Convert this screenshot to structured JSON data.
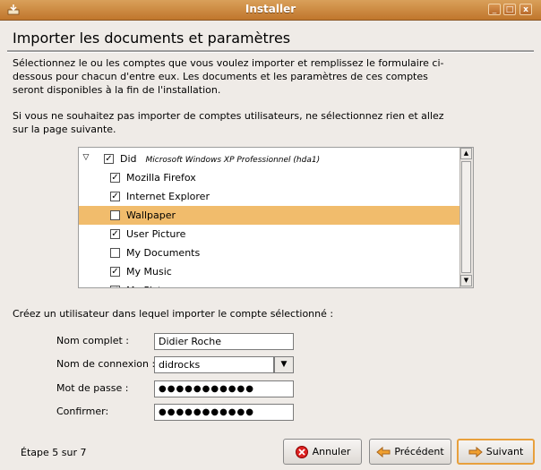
{
  "window": {
    "title": "Installer",
    "minimize_glyph": "_",
    "maximize_glyph": "□",
    "close_glyph": "x"
  },
  "page": {
    "heading": "Importer les documents et paramètres",
    "intro": "Sélectionnez le ou les comptes que vous voulez importer et remplissez le formulaire ci-dessous pour chacun d'entre eux. Les documents et les paramètres de ces comptes seront disponibles à la fin de l'installation.",
    "note": "Si vous ne souhaitez pas importer de comptes utilisateurs, ne sélectionnez rien et allez sur la page suivante."
  },
  "tree": {
    "account": {
      "name": "Did",
      "os": "Microsoft Windows XP Professionnel (hda1)",
      "checked": true,
      "expanded": true
    },
    "items": [
      {
        "label": "Mozilla Firefox",
        "checked": true,
        "selected": false
      },
      {
        "label": "Internet Explorer",
        "checked": true,
        "selected": false
      },
      {
        "label": "Wallpaper",
        "checked": false,
        "selected": true
      },
      {
        "label": "User Picture",
        "checked": true,
        "selected": false
      },
      {
        "label": "My Documents",
        "checked": false,
        "selected": false
      },
      {
        "label": "My Music",
        "checked": true,
        "selected": false
      },
      {
        "label": "My Pictures",
        "checked": true,
        "selected": false
      }
    ]
  },
  "form": {
    "prompt": "Créez un utilisateur dans lequel importer le compte sélectionné :",
    "fullname_label": "Nom complet :",
    "fullname_value": "Didier Roche",
    "login_label": "Nom de connexion :",
    "login_value": "didrocks",
    "password_label": "Mot de passe :",
    "password_mask": "●●●●●●●●●●●",
    "confirm_label": "Confirmer:",
    "confirm_mask": "●●●●●●●●●●●"
  },
  "footer": {
    "step": "Étape 5 sur 7",
    "cancel": "Annuler",
    "back": "Précédent",
    "next": "Suivant"
  },
  "colors": {
    "titlebar": "#c0762c",
    "selection": "#f1bc6c",
    "default_button_border": "#e8a03c"
  }
}
